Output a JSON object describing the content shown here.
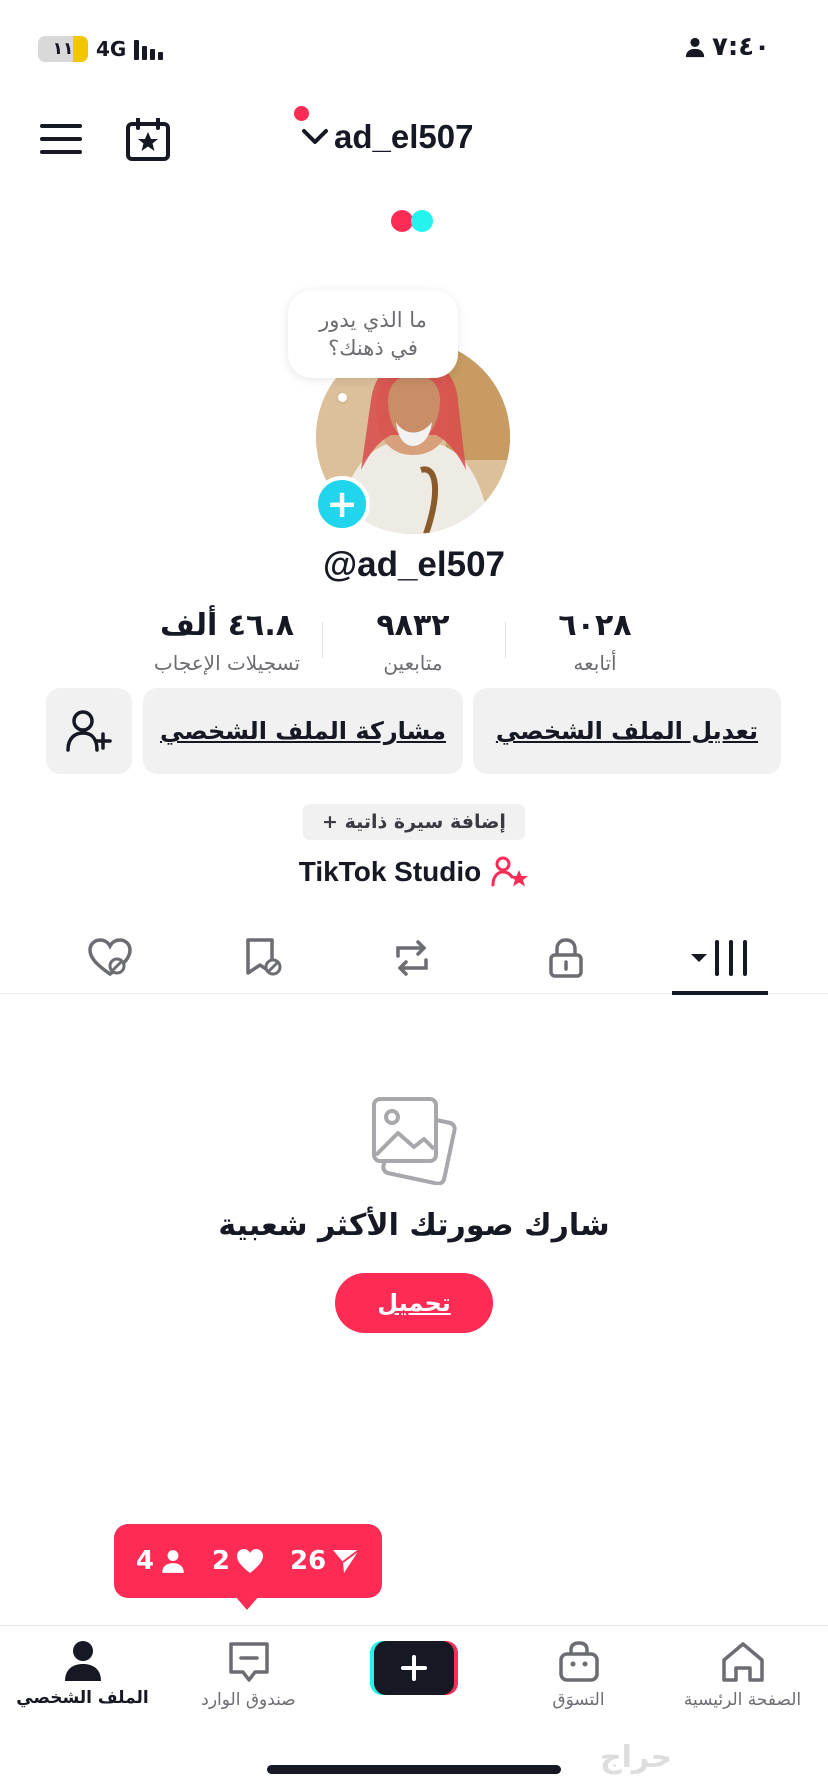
{
  "status_bar": {
    "battery": "١١",
    "network": "4G",
    "time": "٧:٤٠"
  },
  "header": {
    "username": "ad_el507"
  },
  "avatar": {
    "bubble_text": "ما الذي يدور في ذهنك؟"
  },
  "profile": {
    "handle": "@ad_el507",
    "stats": [
      {
        "value": "٦٠٢٨",
        "label": "أتابعه"
      },
      {
        "value": "٩٨٣٢",
        "label": "متابعين"
      },
      {
        "value": "٤٦.٨ ألف",
        "label": "تسجيلات الإعجاب"
      }
    ]
  },
  "actions": {
    "edit_profile": "تعديل الملف الشخصي",
    "share_profile": "مشاركة الملف الشخصي",
    "add_bio": "+ إضافة سيرة ذاتية",
    "studio": "TikTok Studio"
  },
  "empty_state": {
    "title": "شارك صورتك الأكثر شعبية",
    "upload": "تحميل"
  },
  "notification": {
    "followers": "4",
    "likes": "2",
    "shares": "26"
  },
  "bottom_nav": {
    "profile": "الملف الشخصي",
    "inbox": "صندوق الوارد",
    "shop": "التسوَق",
    "home": "الصفحة الرئيسية"
  },
  "watermark": "حراج",
  "colors": {
    "accent": "#fe2c55",
    "cyan": "#20d5ec",
    "text": "#161823",
    "muted": "#6b6d72",
    "button_bg": "#f1f1f2"
  },
  "icons": [
    "hamburger-icon",
    "calendar-star-icon",
    "chevron-down-icon",
    "add-friend-icon",
    "liked-icon",
    "favorites-icon",
    "repost-icon",
    "lock-icon",
    "grid-icon",
    "photos-icon",
    "home-icon",
    "shop-icon",
    "inbox-icon",
    "profile-icon"
  ]
}
